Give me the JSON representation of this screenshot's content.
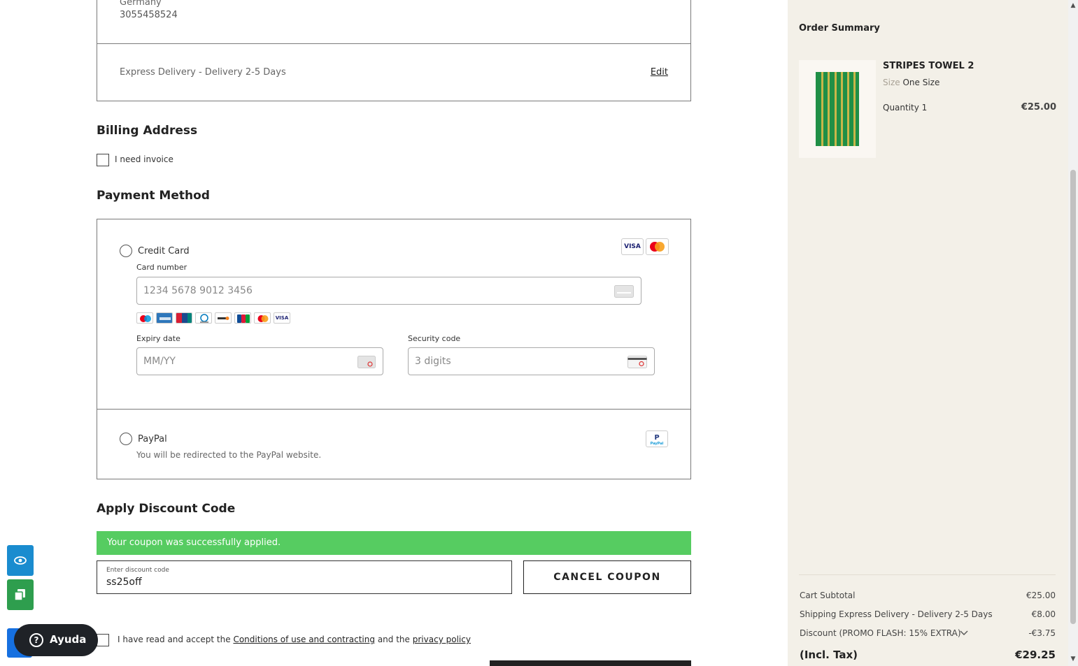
{
  "shipping": {
    "country": "Germany",
    "phone": "3055458524",
    "delivery_method": "Express Delivery - Delivery 2-5 Days",
    "edit_label": "Edit"
  },
  "billing": {
    "heading": "Billing Address",
    "invoice_label": "I need invoice"
  },
  "payment": {
    "heading": "Payment Method",
    "credit_card": {
      "label": "Credit Card",
      "brand_logos": [
        "VISA",
        "Mastercard"
      ],
      "card_number_label": "Card number",
      "card_number_placeholder": "1234 5678 9012 3456",
      "accepted_logos": [
        "Maestro",
        "Amex",
        "UnionPay",
        "Diners",
        "Discover",
        "JCB",
        "Mastercard",
        "VISA"
      ],
      "expiry_label": "Expiry date",
      "expiry_placeholder": "MM/YY",
      "security_label": "Security code",
      "security_placeholder": "3 digits"
    },
    "paypal": {
      "label": "PayPal",
      "note": "You will be redirected to the PayPal website."
    }
  },
  "discount": {
    "heading": "Apply Discount Code",
    "success_message": "Your coupon was successfully applied.",
    "input_label": "Enter discount code",
    "input_value": "ss25off",
    "cancel_label": "CANCEL COUPON"
  },
  "terms": {
    "prefix": "I have read and accept the",
    "conditions_link": "Conditions of use and contracting",
    "middle": "and the",
    "privacy_link": "privacy policy"
  },
  "help_widget": {
    "label": "Ayuda",
    "icon": "?"
  },
  "order_summary": {
    "title": "Order Summary",
    "product": {
      "name": "STRIPES TOWEL 2",
      "size_label": "Size",
      "size_value": "One Size",
      "quantity_label": "Quantity 1",
      "price": "€25.00"
    },
    "rows": [
      {
        "label": "Cart Subtotal",
        "value": "€25.00"
      },
      {
        "label": "Shipping Express Delivery - Delivery 2-5 Days",
        "value": "€8.00"
      },
      {
        "label": "Discount (PROMO FLASH: 15% EXTRA)",
        "value": "-€3.75"
      }
    ],
    "total_label": "(Incl. Tax)",
    "total_value": "€29.25"
  },
  "colors": {
    "success_green": "#56cc61",
    "sidebar_bg": "#f3f0e8",
    "towel_green": "#1f8f46",
    "towel_stripe": "#c9b64a"
  }
}
